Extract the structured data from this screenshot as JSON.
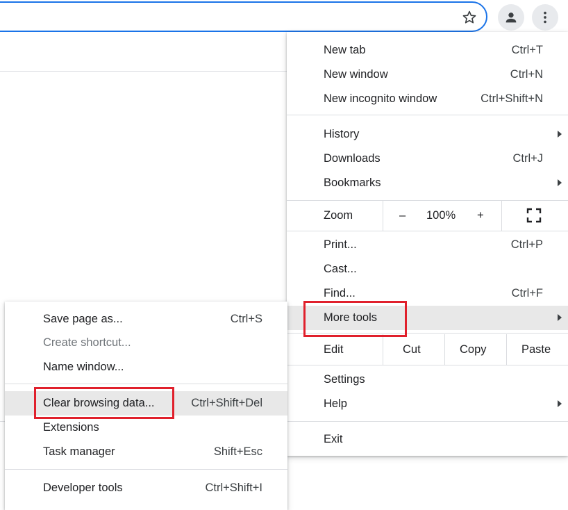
{
  "menu": {
    "items_top": [
      {
        "label": "New tab",
        "shortcut": "Ctrl+T"
      },
      {
        "label": "New window",
        "shortcut": "Ctrl+N"
      },
      {
        "label": "New incognito window",
        "shortcut": "Ctrl+Shift+N"
      }
    ],
    "items_mid": [
      {
        "label": "History",
        "shortcut": ""
      },
      {
        "label": "Downloads",
        "shortcut": "Ctrl+J"
      },
      {
        "label": "Bookmarks",
        "shortcut": ""
      }
    ],
    "zoom": {
      "label": "Zoom",
      "minus": "–",
      "value": "100%",
      "plus": "+"
    },
    "items_tools": [
      {
        "label": "Print...",
        "shortcut": "Ctrl+P"
      },
      {
        "label": "Cast...",
        "shortcut": ""
      },
      {
        "label": "Find...",
        "shortcut": "Ctrl+F"
      },
      {
        "label": "More tools",
        "shortcut": ""
      }
    ],
    "edit": {
      "label": "Edit",
      "cut": "Cut",
      "copy": "Copy",
      "paste": "Paste"
    },
    "items_settings": [
      {
        "label": "Settings",
        "shortcut": ""
      },
      {
        "label": "Help",
        "shortcut": ""
      }
    ],
    "exit": {
      "label": "Exit"
    }
  },
  "submenu": {
    "items": [
      {
        "label": "Save page as...",
        "shortcut": "Ctrl+S"
      },
      {
        "label": "Create shortcut...",
        "shortcut": ""
      },
      {
        "label": "Name window...",
        "shortcut": ""
      },
      {
        "label": "Clear browsing data...",
        "shortcut": "Ctrl+Shift+Del"
      },
      {
        "label": "Extensions",
        "shortcut": ""
      },
      {
        "label": "Task manager",
        "shortcut": "Shift+Esc"
      },
      {
        "label": "Developer tools",
        "shortcut": "Ctrl+Shift+I"
      }
    ]
  },
  "icons": {
    "star": "star-outline-icon",
    "profile": "account-icon",
    "menu": "more-vertical-icon",
    "fullscreen": "fullscreen-icon",
    "submenu_arrow": "caret-right-icon"
  },
  "colors": {
    "focus_ring": "#1a73e8",
    "highlight": "#e8e8e8",
    "annotation": "#e0202c",
    "separator": "#dadce0"
  }
}
